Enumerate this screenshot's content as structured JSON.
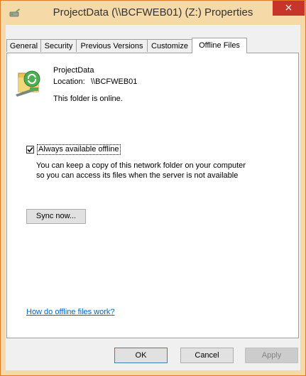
{
  "window": {
    "title": "ProjectData (\\\\BCFWEB01) (Z:) Properties",
    "close_glyph": "×",
    "icon": "network-drive-icon"
  },
  "tabs": [
    {
      "label": "General",
      "active": false
    },
    {
      "label": "Security",
      "active": false
    },
    {
      "label": "Previous Versions",
      "active": false
    },
    {
      "label": "Customize",
      "active": false
    },
    {
      "label": "Offline Files",
      "active": true
    }
  ],
  "folder": {
    "name": "ProjectData",
    "location_label": "Location:",
    "location_value": "\\\\BCFWEB01",
    "status": "This folder is online.",
    "icon": "sync-folder-icon"
  },
  "offline": {
    "checkbox_label": "Always available offline",
    "checked": true,
    "description_line1": "You can keep a copy of this network folder on your computer",
    "description_line2": "so you can access its files when the server is not available",
    "sync_button": "Sync now..."
  },
  "help_link": "How do offline files work?",
  "buttons": {
    "ok": "OK",
    "cancel": "Cancel",
    "apply": "Apply"
  },
  "colors": {
    "titlebar": "#f5d9a6",
    "close": "#c7352a",
    "link": "#0066cc"
  }
}
